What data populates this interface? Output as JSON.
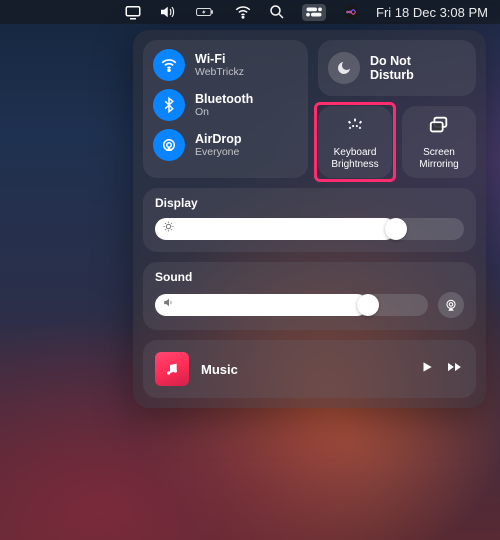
{
  "menubar": {
    "datetime": "Fri 18 Dec  3:08 PM"
  },
  "connectivity": {
    "wifi": {
      "title": "Wi-Fi",
      "subtitle": "WebTrickz"
    },
    "bluetooth": {
      "title": "Bluetooth",
      "subtitle": "On"
    },
    "airdrop": {
      "title": "AirDrop",
      "subtitle": "Everyone"
    }
  },
  "dnd": {
    "line1": "Do Not",
    "line2": "Disturb"
  },
  "tiles": {
    "keyboard": {
      "line1": "Keyboard",
      "line2": "Brightness"
    },
    "mirroring": {
      "line1": "Screen",
      "line2": "Mirroring"
    }
  },
  "display": {
    "heading": "Display",
    "value_pct": 78
  },
  "sound": {
    "heading": "Sound",
    "value_pct": 78
  },
  "music": {
    "title": "Music"
  },
  "colors": {
    "accent_blue": "#0a84ff",
    "highlight": "#ff2d6f",
    "music_tile": "#ff2d55"
  }
}
